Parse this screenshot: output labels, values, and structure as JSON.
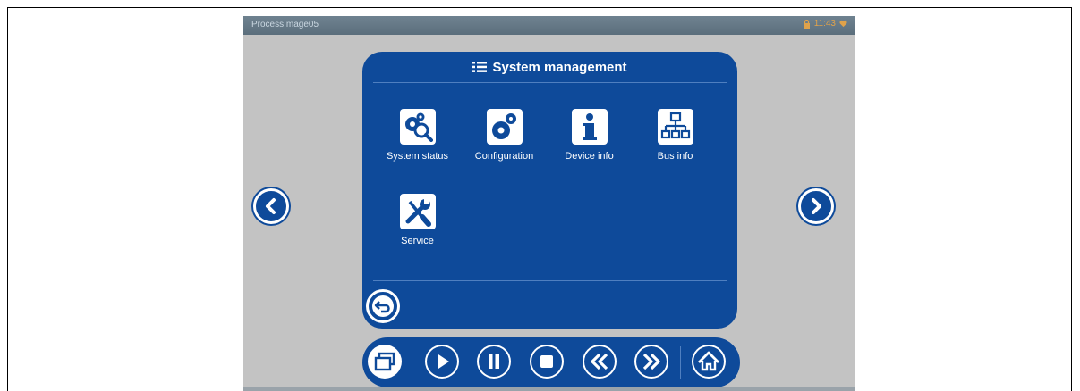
{
  "window": {
    "title": "ProcessImage05",
    "time": "11:43"
  },
  "panel": {
    "title": "System management",
    "tiles": [
      {
        "label": "System status",
        "icon": "gears-magnifier-icon"
      },
      {
        "label": "Configuration",
        "icon": "gears-icon"
      },
      {
        "label": "Device info",
        "icon": "info-icon"
      },
      {
        "label": "Bus info",
        "icon": "network-icon"
      },
      {
        "label": "Service",
        "icon": "wrench-screwdriver-icon"
      }
    ]
  },
  "navigation": {
    "previous": "chevron-left-icon",
    "next": "chevron-right-icon",
    "back": "back-arrow-icon"
  },
  "toolbar": {
    "buttons": [
      "windows-icon",
      "play-icon",
      "pause-icon",
      "stop-icon",
      "rewind-icon",
      "fast-forward-icon",
      "home-icon"
    ]
  },
  "colors": {
    "accent": "#0e4a9a",
    "background": "#c3c3c3",
    "titlebar": "#5b6e7c",
    "status": "#e0a24a"
  }
}
